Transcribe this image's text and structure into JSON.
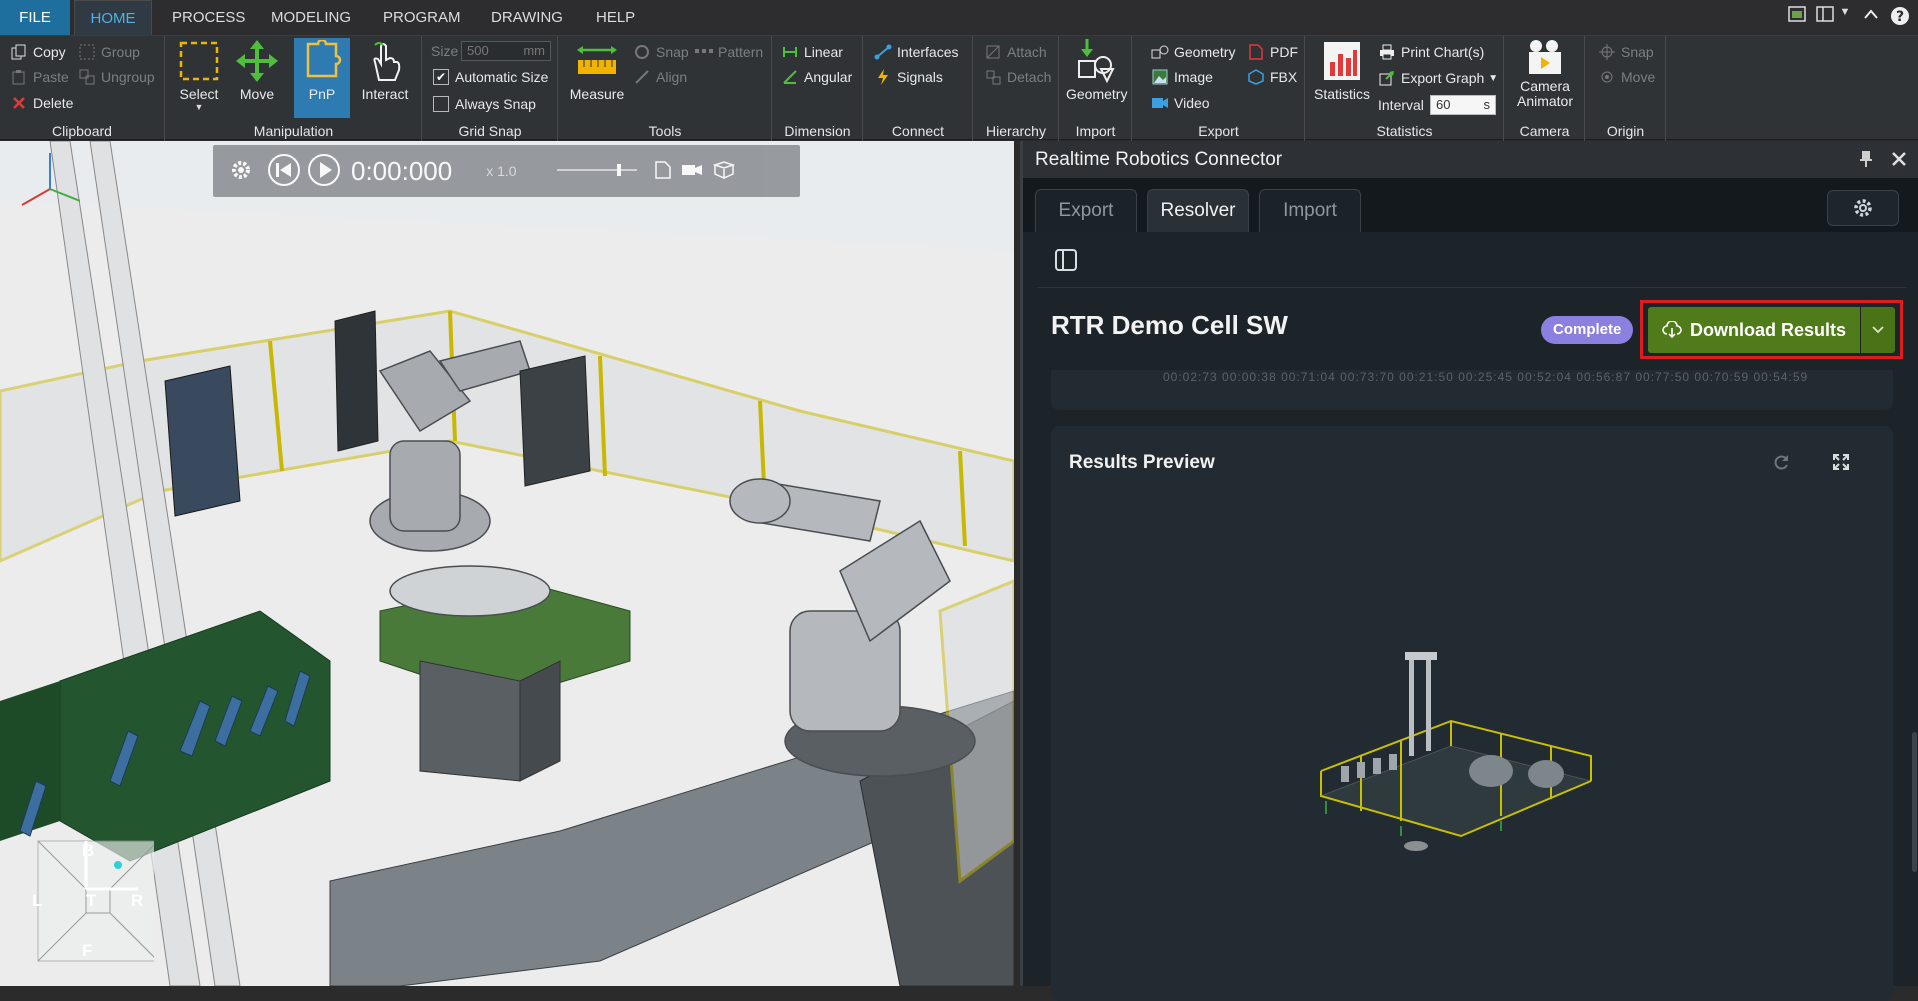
{
  "ribbon_tabs": [
    "FILE",
    "HOME",
    "PROCESS",
    "MODELING",
    "PROGRAM",
    "DRAWING",
    "HELP"
  ],
  "active_tab": "HOME",
  "groups": {
    "clipboard": {
      "title": "Clipboard",
      "copy": "Copy",
      "paste": "Paste",
      "delete": "Delete",
      "group": "Group",
      "ungroup": "Ungroup"
    },
    "manipulation": {
      "title": "Manipulation",
      "select": "Select",
      "move": "Move",
      "pnp": "PnP",
      "interact": "Interact"
    },
    "grid_snap": {
      "title": "Grid Snap",
      "size_label": "Size",
      "size_value": "500",
      "size_unit": "mm",
      "automatic_size": "Automatic Size",
      "always_snap": "Always Snap"
    },
    "tools": {
      "title": "Tools",
      "measure": "Measure",
      "snap": "Snap",
      "pattern": "Pattern",
      "align": "Align"
    },
    "dimension": {
      "title": "Dimension",
      "linear": "Linear",
      "angular": "Angular"
    },
    "connect": {
      "title": "Connect",
      "interfaces": "Interfaces",
      "signals": "Signals"
    },
    "hierarchy": {
      "title": "Hierarchy",
      "attach": "Attach",
      "detach": "Detach"
    },
    "import": {
      "title": "Import",
      "geometry": "Geometry"
    },
    "export": {
      "title": "Export",
      "geometry": "Geometry",
      "image": "Image",
      "video": "Video",
      "pdf": "PDF",
      "fbx": "FBX"
    },
    "statistics": {
      "title": "Statistics",
      "statistics": "Statistics",
      "print_charts": "Print Chart(s)",
      "export_graph": "Export Graph",
      "interval_label": "Interval",
      "interval_value": "60",
      "interval_unit": "s"
    },
    "camera": {
      "title": "Camera",
      "camera_animator_line1": "Camera",
      "camera_animator_line2": "Animator"
    },
    "origin": {
      "title": "Origin",
      "snap": "Snap",
      "move": "Move"
    }
  },
  "playback": {
    "time": "0:00:000",
    "speed": "x 1.0"
  },
  "navcube": {
    "top": "B",
    "left": "L",
    "center": "T",
    "right": "R",
    "bottom": "F"
  },
  "panel": {
    "title": "Realtime Robotics Connector",
    "tabs": [
      "Export",
      "Resolver",
      "Import"
    ],
    "active_tab": "Resolver",
    "cell_name": "RTR Demo Cell SW",
    "status": "Complete",
    "download_label": "Download Results",
    "results_preview_title": "Results Preview",
    "strip_text": "00:02:73   00:00:38   00:71:04   00:73:70   00:21:50   00:25:45   00:52:04   00:56:87   00:77:50   00:70:59   00:54:59"
  },
  "colors": {
    "accent_blue": "#2d7bb0",
    "download_green": "#4f7b1a",
    "badge_purple": "#8b7fe0",
    "highlight_red": "#e01b1b"
  }
}
